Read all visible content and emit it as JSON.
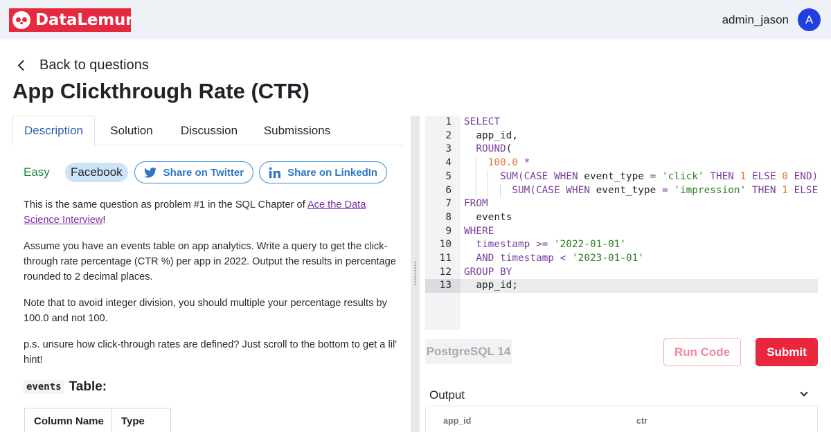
{
  "header": {
    "logo_text": "DataLemur",
    "username": "admin_jason",
    "avatar_initial": "A"
  },
  "nav": {
    "back_label": "Back to questions"
  },
  "question": {
    "title": "App Clickthrough Rate (CTR)",
    "tabs": [
      {
        "label": "Description",
        "active": true
      },
      {
        "label": "Solution",
        "active": false
      },
      {
        "label": "Discussion",
        "active": false
      },
      {
        "label": "Submissions",
        "active": false
      }
    ],
    "difficulty": "Easy",
    "company": "Facebook",
    "share_twitter": "Share on Twitter",
    "share_linkedin": "Share on LinkedIn",
    "p1_before": "This is the same question as problem #1 in the SQL Chapter of ",
    "p1_link": "Ace the Data Science Interview",
    "p1_after": "!",
    "p2": "Assume you have an events table on app analytics. Write a query to get the click-through rate percentage (CTR %) per app in 2022. Output the results in percentage rounded to 2 decimal places.",
    "p3": "Note that to avoid integer division, you should multiple your percentage results by 100.0 and not 100.",
    "p4": "p.s. unsure how click-through rates are defined? Just scroll to the bottom to get a lil' hint!",
    "table_name": "events",
    "table_suffix": "Table:",
    "schema_headers": [
      "Column Name",
      "Type"
    ]
  },
  "editor": {
    "line_numbers": [
      "1",
      "2",
      "3",
      "4",
      "5",
      "6",
      "7",
      "8",
      "9",
      "10",
      "11",
      "12",
      "13"
    ],
    "l1": "SELECT",
    "l2": "app_id,",
    "l3_fn": "ROUND",
    "l3_p": "(",
    "l4_num": "100.0",
    "l4_op": "*",
    "l5_fn": "SUM",
    "l5_a": "(CASE WHEN",
    "l5_b": "event_type",
    "l5_eq": "=",
    "l5_str": "'click'",
    "l5_then": "THEN",
    "l5_n1": "1",
    "l5_else": "ELSE",
    "l5_n0": "0",
    "l5_end": "END)",
    "l6_fn": "SUM",
    "l6_a": "(CASE WHEN",
    "l6_b": "event_type",
    "l6_eq": "=",
    "l6_str": "'impression'",
    "l6_then": "THEN",
    "l6_n1": "1",
    "l6_else": "ELSE",
    "l7": "FROM",
    "l8": "events",
    "l9": "WHERE",
    "l10_col": "timestamp",
    "l10_op": ">=",
    "l10_str": "'2022-01-01'",
    "l11_and": "AND",
    "l11_col": "timestamp",
    "l11_op": "<",
    "l11_str": "'2023-01-01'",
    "l12": "GROUP BY",
    "l13": "app_id;"
  },
  "actions": {
    "dialect": "PostgreSQL 14",
    "run": "Run Code",
    "submit": "Submit"
  },
  "output": {
    "label": "Output",
    "columns": [
      "app_id",
      "ctr"
    ]
  },
  "colors": {
    "brand_red": "#e5293e",
    "link_purple": "#7a2ea8",
    "share_blue": "#3b8ad6",
    "avatar_blue": "#1f3fe0",
    "easy_green": "#1e8a3c"
  }
}
